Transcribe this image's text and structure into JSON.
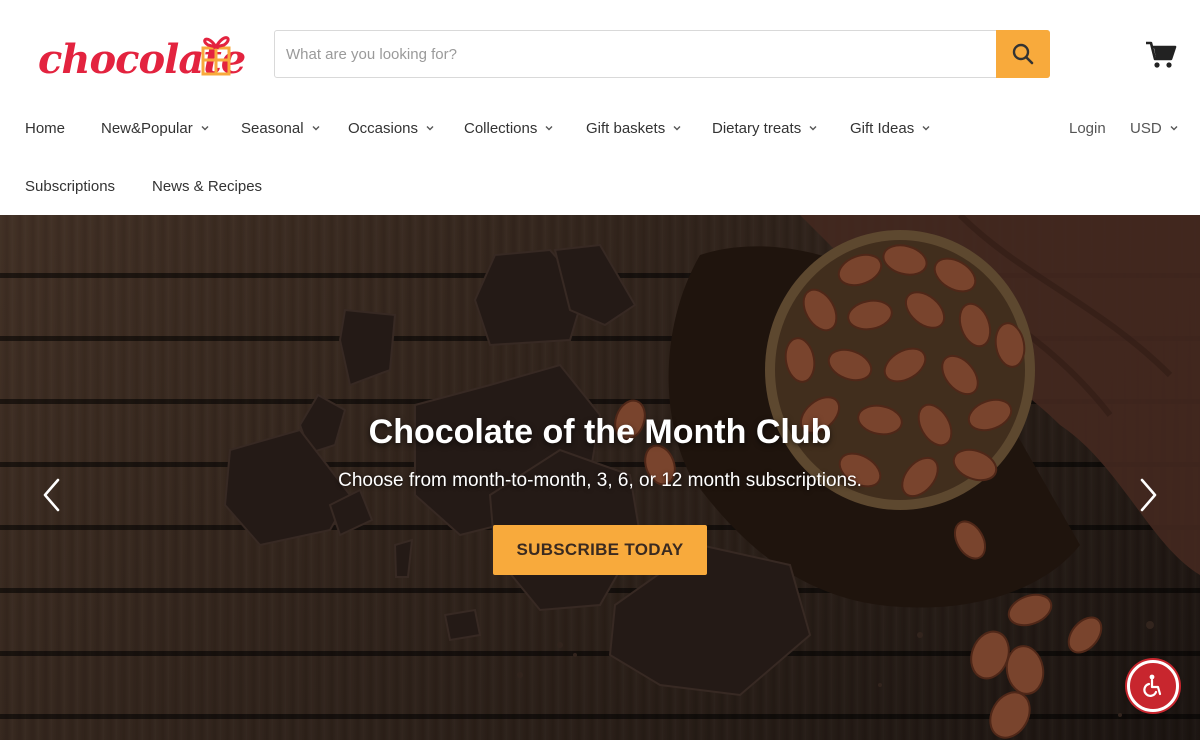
{
  "brand": {
    "logo_text": "chocolate",
    "accent": "#e3233f",
    "cta_color": "#f8aa3c"
  },
  "search": {
    "placeholder": "What are you looking for?",
    "value": "",
    "button_icon": "search-icon"
  },
  "cart": {
    "icon": "cart-icon"
  },
  "nav": {
    "primary": [
      {
        "label": "Home",
        "dropdown": false
      },
      {
        "label": "New&Popular",
        "dropdown": true
      },
      {
        "label": "Seasonal",
        "dropdown": true
      },
      {
        "label": "Occasions",
        "dropdown": true
      },
      {
        "label": "Collections",
        "dropdown": true
      },
      {
        "label": "Gift baskets",
        "dropdown": true
      },
      {
        "label": "Dietary treats",
        "dropdown": true
      },
      {
        "label": "Gift Ideas",
        "dropdown": true
      }
    ],
    "secondary": [
      {
        "label": "Subscriptions"
      },
      {
        "label": "News & Recipes"
      }
    ],
    "login_label": "Login",
    "currency": "USD"
  },
  "hero": {
    "title": "Chocolate of the Month Club",
    "subtitle": "Choose from month-to-month, 3, 6, or 12 month subscriptions.",
    "cta_label": "SUBSCRIBE TODAY",
    "prev_icon": "chevron-left-icon",
    "next_icon": "chevron-right-icon"
  },
  "accessibility": {
    "icon": "accessibility-icon"
  }
}
